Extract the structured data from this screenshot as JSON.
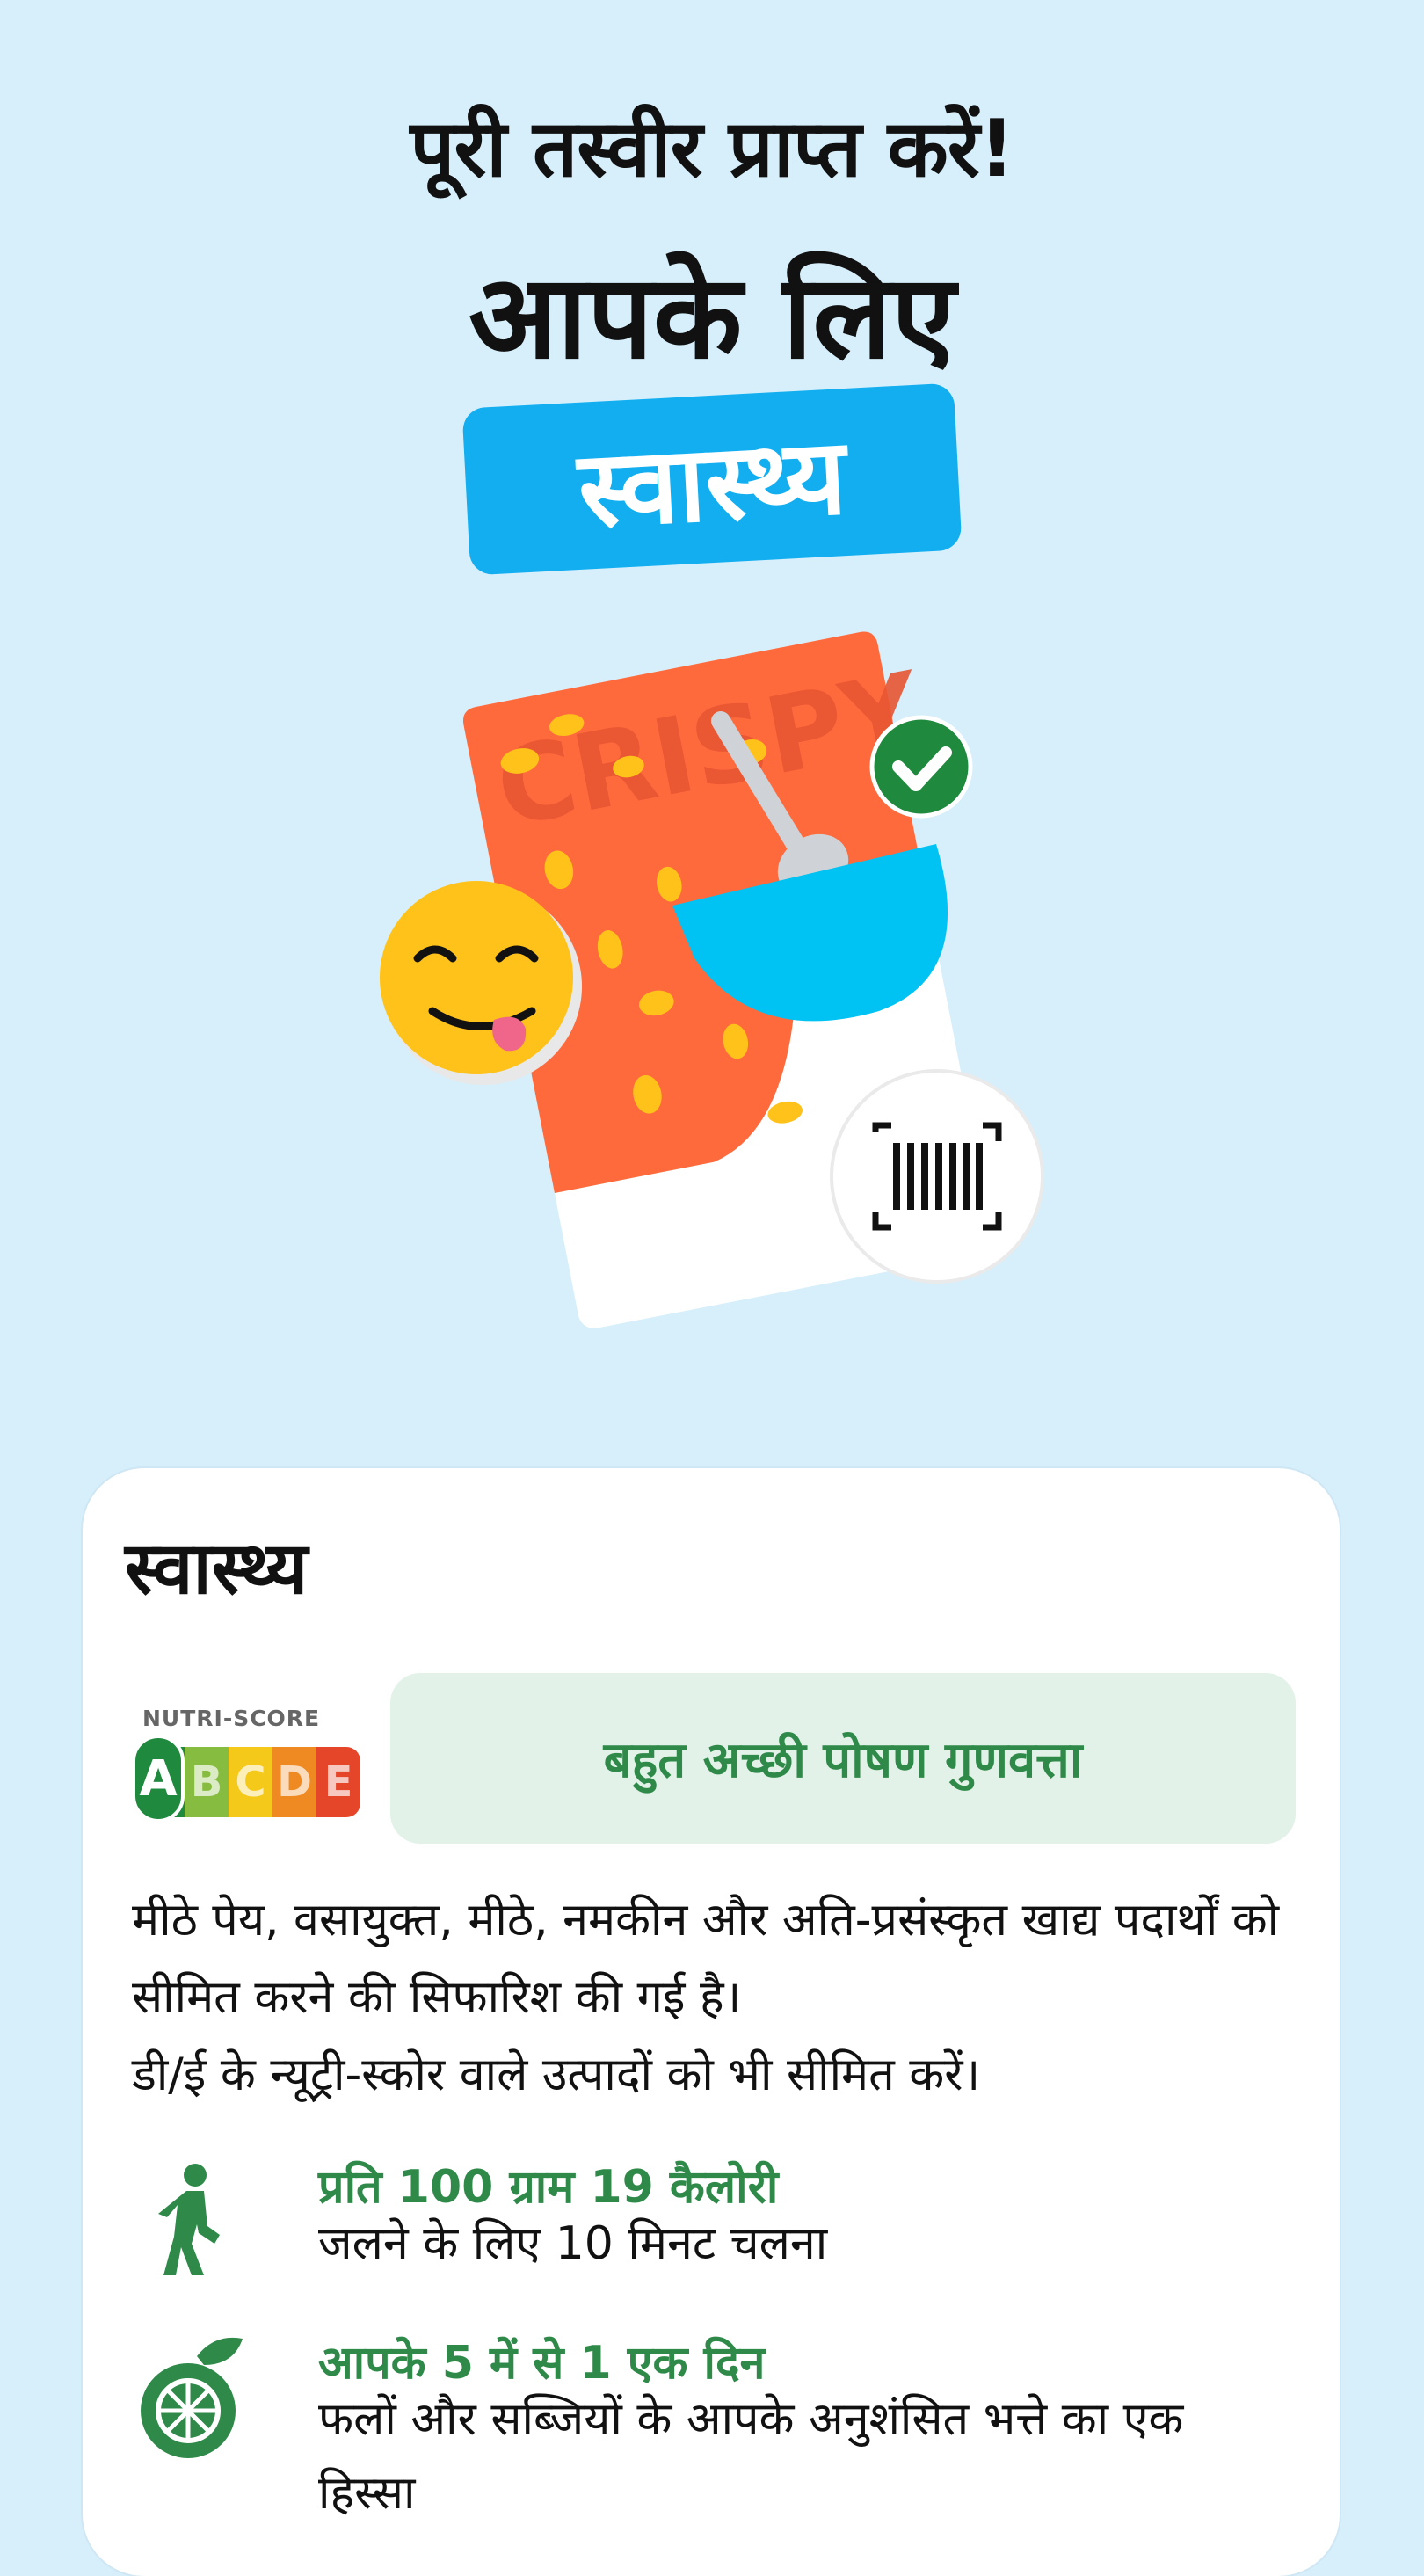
{
  "hero": {
    "title": "पूरी तस्वीर प्राप्त करें!",
    "subtitle": "आपके लिए",
    "pill_label": "स्वास्थ्य",
    "pill_color": "#12aef0",
    "box_text": "CRISPY"
  },
  "illustration": {
    "icons": [
      "cereal-box-icon",
      "spoon-icon",
      "bowl-icon",
      "check-badge-icon",
      "tongue-emoji-icon",
      "barcode-icon"
    ]
  },
  "card": {
    "title": "स्वास्थ्य",
    "nutriscore": {
      "label": "NUTRI-SCORE",
      "grade": "A",
      "letters": [
        "A",
        "B",
        "C",
        "D",
        "E"
      ],
      "colors": [
        "#1f8a3e",
        "#86bc3f",
        "#f5c91a",
        "#ef8a22",
        "#e5462a"
      ]
    },
    "quality_text": "बहुत अच्छी पोषण गुणवत्ता",
    "paragraph_1": "मीठे पेय, वसायुक्त, मीठे, नमकीन और अति-प्रसंस्कृत खाद्य पदार्थों को सीमित करने की सिफारिश की गई है।",
    "paragraph_2": "डी/ई के न्यूट्री-स्कोर वाले उत्पादों को भी सीमित करें।",
    "rows": [
      {
        "icon": "walking-person-icon",
        "title": "प्रति 100 ग्राम 19 कैलोरी",
        "text": "जलने के लिए 10 मिनट चलना"
      },
      {
        "icon": "fruit-icon",
        "title": "आपके 5 में से 1 एक दिन",
        "text": "फलों और सब्जियों के आपके अनुशंसित भत्ते का एक हिस्सा"
      }
    ],
    "accent_green": "#2f8a4a"
  }
}
